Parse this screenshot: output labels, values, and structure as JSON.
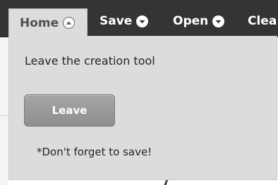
{
  "toolbar": {
    "tabs": [
      {
        "label": "Home",
        "icon": "chevron-up-icon",
        "active": true
      },
      {
        "label": "Save",
        "icon": "chevron-down-icon",
        "active": false
      },
      {
        "label": "Open",
        "icon": "chevron-down-icon",
        "active": false
      },
      {
        "label": "Clea",
        "icon": "",
        "active": false
      }
    ]
  },
  "panel": {
    "description": "Leave the creation tool",
    "leave_button_label": "Leave",
    "note": "*Don't forget to save!"
  },
  "colors": {
    "toolbar_bg": "#2e2e2e",
    "panel_bg": "#dcdcdc",
    "button_bg": "#9a9a9a",
    "tab_text_dark": "#ffffff",
    "tab_text_active": "#505050"
  }
}
